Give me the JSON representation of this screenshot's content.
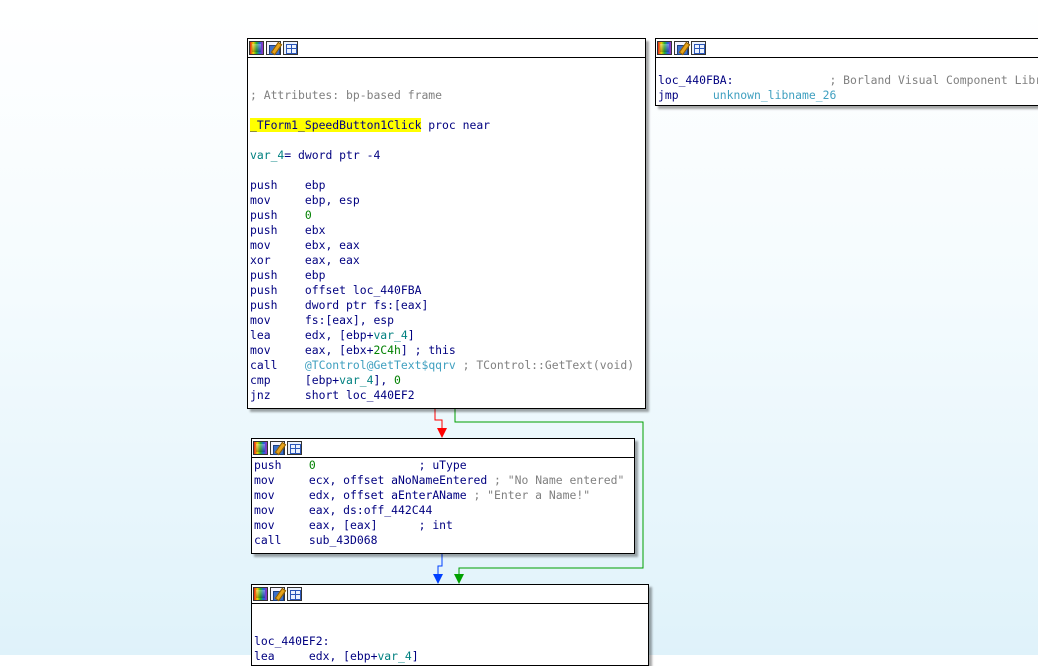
{
  "nodes": {
    "main": {
      "lines": [
        {
          "text": ""
        },
        {
          "text": ""
        },
        {
          "text": "; Attributes: bp-based frame",
          "cls": "gray"
        },
        {
          "text": ""
        },
        {
          "parts": [
            {
              "t": "_TForm1_SpeedButton1Click",
              "c": "hl"
            },
            {
              "t": " proc near",
              "c": "mn"
            }
          ]
        },
        {
          "text": ""
        },
        {
          "parts": [
            {
              "t": "var_4",
              "c": "var"
            },
            {
              "t": "= dword ptr -4",
              "c": "mn"
            }
          ]
        },
        {
          "text": ""
        },
        {
          "parts": [
            {
              "t": "push    ",
              "c": "mn"
            },
            {
              "t": "ebp",
              "c": "op"
            }
          ]
        },
        {
          "parts": [
            {
              "t": "mov     ",
              "c": "mn"
            },
            {
              "t": "ebp, esp",
              "c": "op"
            }
          ]
        },
        {
          "parts": [
            {
              "t": "push    ",
              "c": "mn"
            },
            {
              "t": "0",
              "c": "num"
            }
          ]
        },
        {
          "parts": [
            {
              "t": "push    ",
              "c": "mn"
            },
            {
              "t": "ebx",
              "c": "op"
            }
          ]
        },
        {
          "parts": [
            {
              "t": "mov     ",
              "c": "mn"
            },
            {
              "t": "ebx, eax",
              "c": "op"
            }
          ]
        },
        {
          "parts": [
            {
              "t": "xor     ",
              "c": "mn"
            },
            {
              "t": "eax, eax",
              "c": "op"
            }
          ]
        },
        {
          "parts": [
            {
              "t": "push    ",
              "c": "mn"
            },
            {
              "t": "ebp",
              "c": "op"
            }
          ]
        },
        {
          "parts": [
            {
              "t": "push    ",
              "c": "mn"
            },
            {
              "t": "offset loc_440FBA",
              "c": "op"
            }
          ]
        },
        {
          "parts": [
            {
              "t": "push    ",
              "c": "mn"
            },
            {
              "t": "dword ptr fs:[eax]",
              "c": "op"
            }
          ]
        },
        {
          "parts": [
            {
              "t": "mov     ",
              "c": "mn"
            },
            {
              "t": "fs:[eax], esp",
              "c": "op"
            }
          ]
        },
        {
          "parts": [
            {
              "t": "lea     ",
              "c": "mn"
            },
            {
              "t": "edx, [ebp+",
              "c": "op"
            },
            {
              "t": "var_4",
              "c": "var"
            },
            {
              "t": "]",
              "c": "op"
            }
          ]
        },
        {
          "parts": [
            {
              "t": "mov     ",
              "c": "mn"
            },
            {
              "t": "eax, [ebx+",
              "c": "op"
            },
            {
              "t": "2C4h",
              "c": "num"
            },
            {
              "t": "] ",
              "c": "op"
            },
            {
              "t": "; this",
              "c": "mn"
            }
          ]
        },
        {
          "parts": [
            {
              "t": "call    ",
              "c": "mn"
            },
            {
              "t": "@TControl@GetText$qqrv",
              "c": "lib"
            },
            {
              "t": " ; TControl::GetText(void)",
              "c": "gray"
            }
          ]
        },
        {
          "parts": [
            {
              "t": "cmp     ",
              "c": "mn"
            },
            {
              "t": "[ebp+",
              "c": "op"
            },
            {
              "t": "var_4",
              "c": "var"
            },
            {
              "t": "], ",
              "c": "op"
            },
            {
              "t": "0",
              "c": "num"
            }
          ]
        },
        {
          "parts": [
            {
              "t": "jnz     ",
              "c": "mn"
            },
            {
              "t": "short loc_440EF2",
              "c": "op"
            }
          ]
        }
      ]
    },
    "handler": {
      "lines": [
        {
          "text": ""
        },
        {
          "parts": [
            {
              "t": "loc_440FBA:",
              "c": "mn"
            },
            {
              "t": "              ; Borland Visual Component Library",
              "c": "gray"
            }
          ]
        },
        {
          "parts": [
            {
              "t": "jmp     ",
              "c": "mn"
            },
            {
              "t": "unknown_libname_26",
              "c": "lib"
            }
          ]
        }
      ]
    },
    "msgbox": {
      "lines": [
        {
          "parts": [
            {
              "t": "push    ",
              "c": "mn"
            },
            {
              "t": "0",
              "c": "num"
            },
            {
              "t": "               ; uType",
              "c": "mn"
            }
          ]
        },
        {
          "parts": [
            {
              "t": "mov     ",
              "c": "mn"
            },
            {
              "t": "ecx, offset aNoNameEntered",
              "c": "op"
            },
            {
              "t": " ; \"No Name entered\"",
              "c": "gray"
            }
          ]
        },
        {
          "parts": [
            {
              "t": "mov     ",
              "c": "mn"
            },
            {
              "t": "edx, offset aEnterAName",
              "c": "op"
            },
            {
              "t": " ; \"Enter a Name!\"",
              "c": "gray"
            }
          ]
        },
        {
          "parts": [
            {
              "t": "mov     ",
              "c": "mn"
            },
            {
              "t": "eax, ds:off_442C44",
              "c": "op"
            }
          ]
        },
        {
          "parts": [
            {
              "t": "mov     ",
              "c": "mn"
            },
            {
              "t": "eax, [eax]",
              "c": "op"
            },
            {
              "t": "      ; int",
              "c": "mn"
            }
          ]
        },
        {
          "parts": [
            {
              "t": "call    ",
              "c": "mn"
            },
            {
              "t": "sub_43D068",
              "c": "op"
            }
          ]
        }
      ]
    },
    "tail": {
      "lines": [
        {
          "text": ""
        },
        {
          "text": ""
        },
        {
          "parts": [
            {
              "t": "loc_440EF2:",
              "c": "mn"
            }
          ]
        },
        {
          "parts": [
            {
              "t": "lea     ",
              "c": "mn"
            },
            {
              "t": "edx, [ebp+",
              "c": "op"
            },
            {
              "t": "var_4",
              "c": "var"
            },
            {
              "t": "]",
              "c": "op"
            }
          ]
        }
      ]
    }
  },
  "colors": {
    "edge_false": "#ff0000",
    "edge_true": "#00a000",
    "edge_flow": "#0040ff"
  }
}
